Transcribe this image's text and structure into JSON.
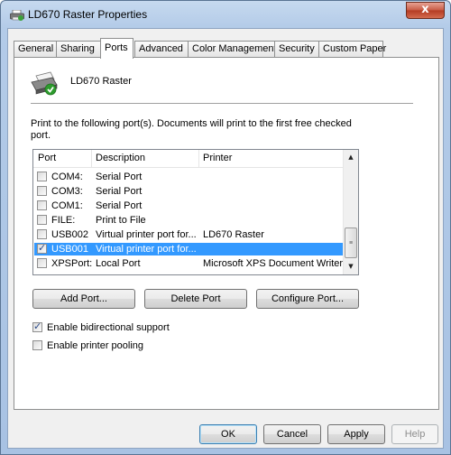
{
  "window": {
    "title": "LD670 Raster Properties",
    "close_label": "x"
  },
  "tabs": [
    {
      "label": "General",
      "active": false
    },
    {
      "label": "Sharing",
      "active": false
    },
    {
      "label": "Ports",
      "active": true
    },
    {
      "label": "Advanced",
      "active": false
    },
    {
      "label": "Color Management",
      "active": false
    },
    {
      "label": "Security",
      "active": false
    },
    {
      "label": "Custom Paper",
      "active": false
    }
  ],
  "printer": {
    "name": "LD670 Raster",
    "icon": "printer-icon"
  },
  "instruction": "Print to the following port(s). Documents will print to the first free checked port.",
  "port_list": {
    "columns": [
      "Port",
      "Description",
      "Printer"
    ],
    "rows": [
      {
        "port": "COM4:",
        "description": "Serial Port",
        "printer": "",
        "checked": false,
        "selected": false
      },
      {
        "port": "COM3:",
        "description": "Serial Port",
        "printer": "",
        "checked": false,
        "selected": false
      },
      {
        "port": "COM1:",
        "description": "Serial Port",
        "printer": "",
        "checked": false,
        "selected": false
      },
      {
        "port": "FILE:",
        "description": "Print to File",
        "printer": "",
        "checked": false,
        "selected": false
      },
      {
        "port": "USB002",
        "description": "Virtual printer port for...",
        "printer": "LD670 Raster",
        "checked": false,
        "selected": false
      },
      {
        "port": "USB001",
        "description": "Virtual printer port for...",
        "printer": "",
        "checked": true,
        "selected": true
      },
      {
        "port": "XPSPort:",
        "description": "Local Port",
        "printer": "Microsoft XPS Document Writer",
        "checked": false,
        "selected": false
      }
    ]
  },
  "port_buttons": {
    "add": "Add Port...",
    "delete": "Delete Port",
    "configure": "Configure Port..."
  },
  "options": {
    "bidirectional": {
      "label": "Enable bidirectional support",
      "checked": true
    },
    "pooling": {
      "label": "Enable printer pooling",
      "checked": false
    }
  },
  "dialog_buttons": {
    "ok": "OK",
    "cancel": "Cancel",
    "apply": "Apply",
    "help": "Help"
  },
  "colors": {
    "selection": "#3399ff",
    "title_gradient_top": "#c6d9ef",
    "close": "#c75a44"
  }
}
